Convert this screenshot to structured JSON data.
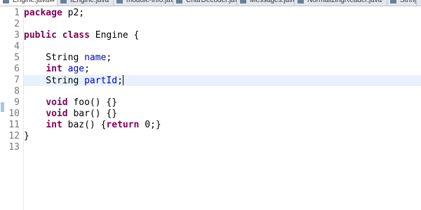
{
  "tabs": [
    {
      "label": "Engine.java",
      "active": true,
      "close": "⊠"
    },
    {
      "label": "IEngine.java",
      "active": false
    },
    {
      "label": "module-info.java",
      "active": false
    },
    {
      "label": "CharDecoder.java",
      "active": false
    },
    {
      "label": "Messages.java",
      "active": false
    },
    {
      "label": "NormalizingReader.java",
      "active": false
    },
    {
      "label": "StringDec",
      "active": false
    }
  ],
  "editor": {
    "line_numbers": [
      "1",
      "2",
      "3",
      "4",
      "5",
      "6",
      "7",
      "8",
      "9",
      "10",
      "11",
      "12",
      "13"
    ],
    "current_line": 7,
    "lines": [
      [
        {
          "t": "package",
          "c": "kw"
        },
        {
          "t": " p2;",
          "c": ""
        }
      ],
      [],
      [
        {
          "t": "public",
          "c": "kw"
        },
        {
          "t": " ",
          "c": ""
        },
        {
          "t": "class",
          "c": "kw"
        },
        {
          "t": " Engine {",
          "c": ""
        }
      ],
      [],
      [
        {
          "t": "    String ",
          "c": ""
        },
        {
          "t": "name",
          "c": "field"
        },
        {
          "t": ";",
          "c": ""
        }
      ],
      [
        {
          "t": "    ",
          "c": ""
        },
        {
          "t": "int",
          "c": "kw"
        },
        {
          "t": " ",
          "c": ""
        },
        {
          "t": "age",
          "c": "field"
        },
        {
          "t": ";",
          "c": ""
        }
      ],
      [
        {
          "t": "    String ",
          "c": ""
        },
        {
          "t": "partId",
          "c": "field"
        },
        {
          "t": ";",
          "c": ""
        }
      ],
      [],
      [
        {
          "t": "    ",
          "c": ""
        },
        {
          "t": "void",
          "c": "kw"
        },
        {
          "t": " foo() {}",
          "c": ""
        }
      ],
      [
        {
          "t": "    ",
          "c": ""
        },
        {
          "t": "void",
          "c": "kw"
        },
        {
          "t": " bar() {}",
          "c": ""
        }
      ],
      [
        {
          "t": "    ",
          "c": ""
        },
        {
          "t": "int",
          "c": "kw"
        },
        {
          "t": " baz() {",
          "c": ""
        },
        {
          "t": "return",
          "c": "kw"
        },
        {
          "t": " 0;}",
          "c": ""
        }
      ],
      [
        {
          "t": "}",
          "c": ""
        }
      ],
      []
    ]
  },
  "colors": {
    "keyword": "#7f0055",
    "field": "#0000c0",
    "current_line": "#e8f2fe",
    "line_number": "#787878",
    "annotation_marker": "#a9c6e6"
  }
}
